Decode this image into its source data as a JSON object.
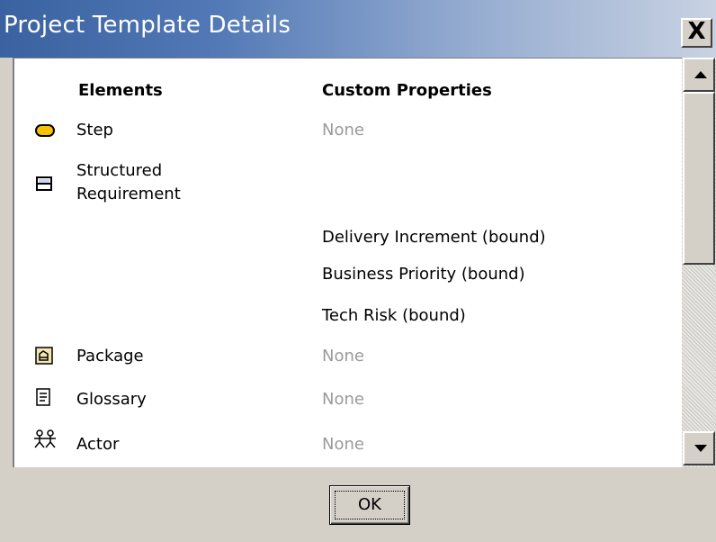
{
  "window": {
    "title": "Project Template Details",
    "close_glyph": "X"
  },
  "table": {
    "headers": {
      "elements": "Elements",
      "custom_properties": "Custom Properties"
    },
    "rows": [
      {
        "element": "Step",
        "icon": "step-icon",
        "property": "None"
      },
      {
        "element_line1": "Structured",
        "element_line2": "Requirement",
        "icon": "structured-requirement-icon",
        "properties": [
          "Delivery Increment (bound)",
          "Business Priority (bound)",
          "Tech Risk (bound)"
        ]
      },
      {
        "element": "Package",
        "icon": "package-icon",
        "property": "None"
      },
      {
        "element": "Glossary",
        "icon": "glossary-icon",
        "property": "None"
      },
      {
        "element": "Actor",
        "icon": "actor-icon",
        "property": "None"
      }
    ]
  },
  "buttons": {
    "ok_label": "OK"
  },
  "colors": {
    "muted_text": "#9a9a9a",
    "title_gradient_start": "#3a62a0",
    "step_icon_fill": "#f5c400"
  }
}
